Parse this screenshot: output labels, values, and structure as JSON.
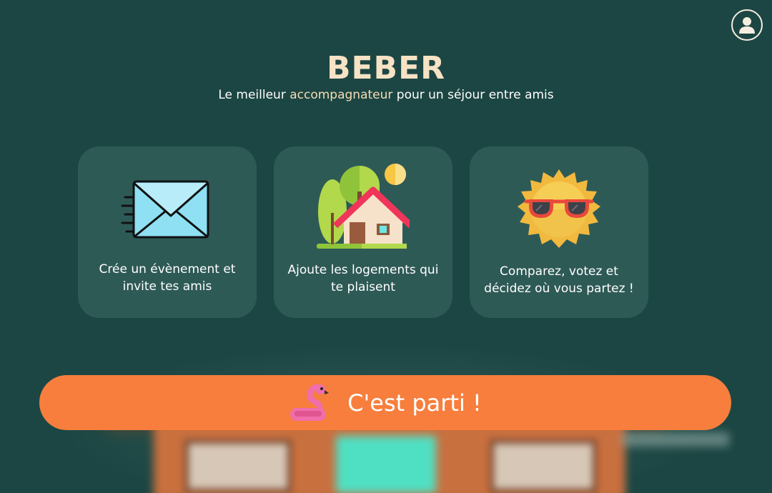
{
  "header": {
    "title": "BEBER",
    "subtitle_before": "Le meilleur ",
    "subtitle_accent": "accompagnateur",
    "subtitle_after": " pour un séjour entre amis"
  },
  "features": [
    {
      "label": "Crée un évènement et invite tes amis",
      "icon": "envelope-icon"
    },
    {
      "label": "Ajoute les logements qui te plaisent",
      "icon": "house-icon"
    },
    {
      "label": "Comparez, votez et décidez où vous partez !",
      "icon": "sun-sunglasses-icon"
    }
  ],
  "cta": {
    "label": "C'est parti !",
    "icon": "flamingo-icon"
  },
  "account": {
    "icon": "user-icon"
  },
  "colors": {
    "background": "#1c4643",
    "card": "#2e5a56",
    "accent": "#f6ddb5",
    "cta": "#f77e3d"
  }
}
